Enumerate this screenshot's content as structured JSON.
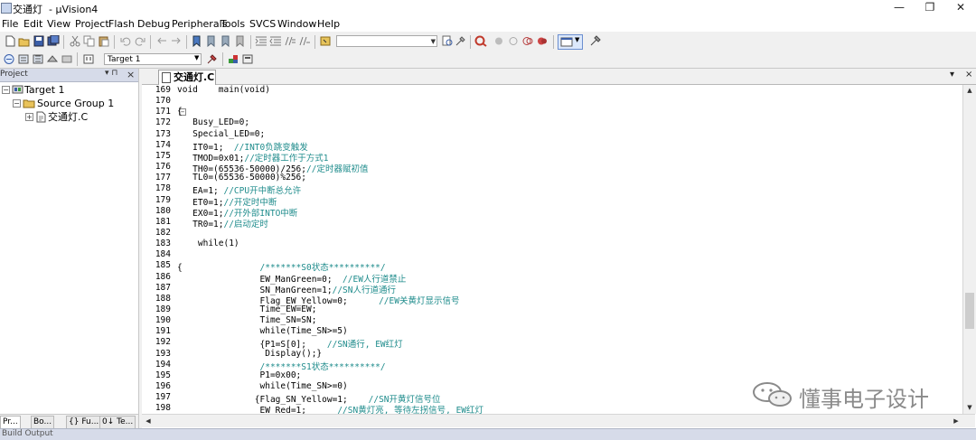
{
  "window": {
    "title": "交通灯  - µVision4",
    "controls": [
      "—",
      "❐",
      "✕"
    ]
  },
  "menu": [
    "File",
    "Edit",
    "View",
    "Project",
    "Flash",
    "Debug",
    "Peripherals",
    "Tools",
    "SVCS",
    "Window",
    "Help"
  ],
  "toolbar": {
    "target_combo": "Target 1"
  },
  "project_panel": {
    "header": "Project",
    "pin": "▾ ⊓",
    "close": "×",
    "tree": [
      {
        "label": "Target 1",
        "level": 0,
        "expander": "−"
      },
      {
        "label": "Source Group 1",
        "level": 1,
        "expander": "−"
      },
      {
        "label": "交通灯.C",
        "level": 2,
        "expander": "+"
      }
    ],
    "tabs": [
      "Pr...",
      "Bo...",
      "{} Fu...",
      "0↓ Te..."
    ]
  },
  "editor": {
    "tab_label": "交通灯.C",
    "tab_controls": [
      "▾",
      "×"
    ],
    "lines": [
      {
        "n": "169",
        "code": "void    main(void)",
        "comment": ""
      },
      {
        "n": "170",
        "code": "",
        "comment": ""
      },
      {
        "n": "171",
        "code": "{",
        "comment": "",
        "fold": "−"
      },
      {
        "n": "172",
        "code": "   Busy_LED=0;",
        "comment": ""
      },
      {
        "n": "173",
        "code": "   Special_LED=0;",
        "comment": ""
      },
      {
        "n": "174",
        "code": "   IT0=1;  ",
        "comment": "//INT0负跳变触发"
      },
      {
        "n": "175",
        "code": "   TMOD=0x01;",
        "comment": "//定时器工作于方式1"
      },
      {
        "n": "176",
        "code": "   TH0=(65536-50000)/256;",
        "comment": "//定时器赋初值"
      },
      {
        "n": "177",
        "code": "   TL0=(65536-50000)%256;",
        "comment": ""
      },
      {
        "n": "178",
        "code": "   EA=1; ",
        "comment": "//CPU开中断总允许"
      },
      {
        "n": "179",
        "code": "   ET0=1;",
        "comment": "//开定时中断"
      },
      {
        "n": "180",
        "code": "   EX0=1;",
        "comment": "//开外部INTO中断"
      },
      {
        "n": "181",
        "code": "   TR0=1;",
        "comment": "//启动定时"
      },
      {
        "n": "182",
        "code": "",
        "comment": ""
      },
      {
        "n": "183",
        "code": "    while(1)",
        "comment": ""
      },
      {
        "n": "184",
        "code": "",
        "comment": ""
      },
      {
        "n": "185",
        "code": "{               ",
        "comment": "/*******S0状态**********/"
      },
      {
        "n": "186",
        "code": "                EW_ManGreen=0;  ",
        "comment": "//EW人行道禁止"
      },
      {
        "n": "187",
        "code": "                SN_ManGreen=1;",
        "comment": "//SN人行道通行"
      },
      {
        "n": "188",
        "code": "                Flag_EW_Yellow=0;      ",
        "comment": "//EW关黄灯显示信号"
      },
      {
        "n": "189",
        "code": "                Time_EW=EW;",
        "comment": ""
      },
      {
        "n": "190",
        "code": "                Time_SN=SN;",
        "comment": ""
      },
      {
        "n": "191",
        "code": "                while(Time_SN>=5)",
        "comment": ""
      },
      {
        "n": "192",
        "code": "                {P1=S[0];    ",
        "comment": "//SN通行, EW红灯"
      },
      {
        "n": "193",
        "code": "                 Display();}",
        "comment": ""
      },
      {
        "n": "194",
        "code": "                ",
        "comment": "/*******S1状态**********/"
      },
      {
        "n": "195",
        "code": "                P1=0x00;",
        "comment": ""
      },
      {
        "n": "196",
        "code": "                while(Time_SN>=0)",
        "comment": ""
      },
      {
        "n": "197",
        "code": "               {Flag_SN_Yellow=1;    ",
        "comment": "//SN开黄灯信号位"
      },
      {
        "n": "198",
        "code": "                EW_Red=1;      ",
        "comment": "//SN黄灯亮, 等待左拐信号, EW红灯"
      }
    ]
  },
  "build_output": {
    "header": "Build Output"
  },
  "watermark": {
    "text": "懂事电子设计"
  }
}
